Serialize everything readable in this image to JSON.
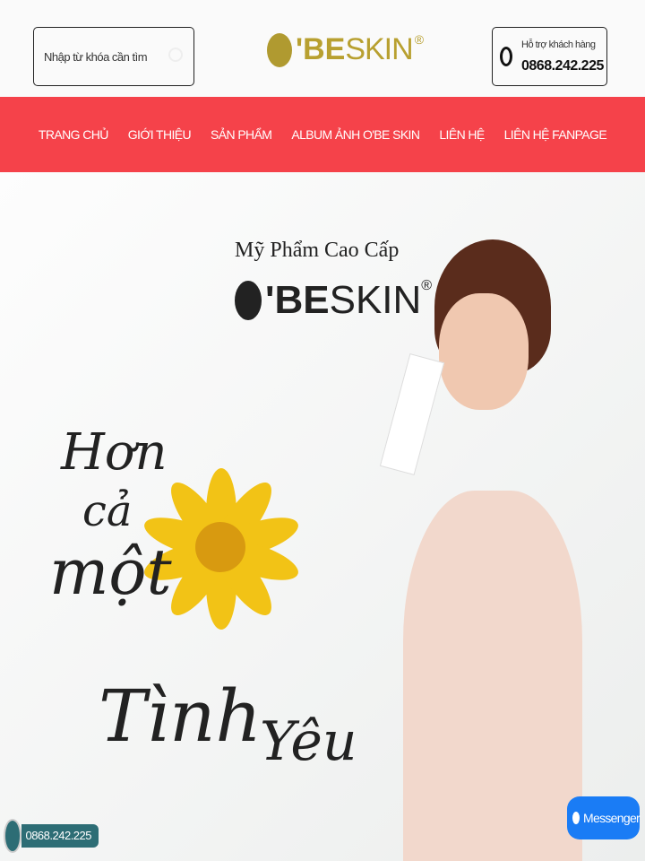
{
  "header": {
    "search_placeholder": "Nhập từ khóa cần tìm",
    "logo_text": "O'BESKIN",
    "logo_bold": "'BE",
    "logo_thin": "SKIN",
    "support_label": "Hỗ trợ khách hàng",
    "support_phone": "0868.242.225"
  },
  "nav": [
    "TRANG CHỦ",
    "GIỚI THIỆU",
    "SẢN PHẨM",
    "ALBUM ẢNH O'BE SKIN",
    "LIÊN HỆ",
    "LIÊN HỆ FANPAGE"
  ],
  "hero": {
    "subtitle": "Mỹ Phẩm Cao Cấp",
    "brand_bold": "'BE",
    "brand_thin": "SKIN",
    "script_lines": [
      "Hơn",
      "cả",
      "một",
      "Tình",
      "Yêu"
    ]
  },
  "floating": {
    "call_phone": "0868.242.225",
    "messenger": "Messenger"
  }
}
